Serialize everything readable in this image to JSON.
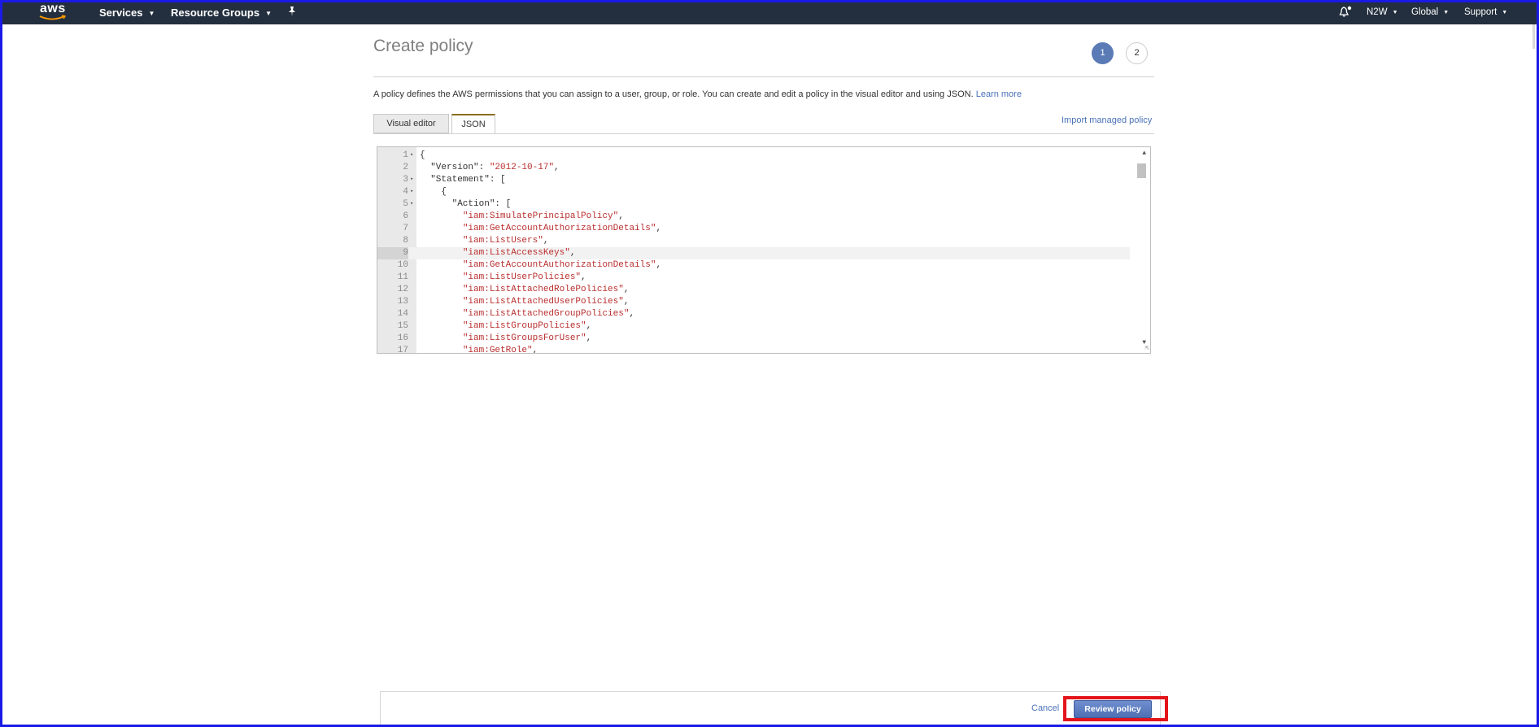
{
  "topnav": {
    "logo": "aws",
    "services": "Services",
    "resource_groups": "Resource Groups",
    "pin_icon": "pin-icon",
    "bell_icon": "bell-icon",
    "account": "N2W",
    "region": "Global",
    "support": "Support"
  },
  "page": {
    "title": "Create policy",
    "steps": [
      "1",
      "2"
    ],
    "active_step": "1",
    "description": "A policy defines the AWS permissions that you can assign to a user, group, or role. You can create and edit a policy in the visual editor and using JSON.",
    "learn_more": "Learn more"
  },
  "tabs": {
    "visual_editor": "Visual editor",
    "json": "JSON",
    "active": "JSON"
  },
  "import_link": "Import managed policy",
  "editor": {
    "active_line": 9,
    "lines": [
      {
        "n": "1",
        "fold": true,
        "pre": "{",
        "s": "",
        "post": ""
      },
      {
        "n": "2",
        "fold": false,
        "pre": "  \"Version\": ",
        "s": "\"2012-10-17\"",
        "post": ","
      },
      {
        "n": "3",
        "fold": true,
        "pre": "  \"Statement\": [",
        "s": "",
        "post": ""
      },
      {
        "n": "4",
        "fold": true,
        "pre": "    {",
        "s": "",
        "post": ""
      },
      {
        "n": "5",
        "fold": true,
        "pre": "      \"Action\": [",
        "s": "",
        "post": ""
      },
      {
        "n": "6",
        "fold": false,
        "pre": "        ",
        "s": "\"iam:SimulatePrincipalPolicy\"",
        "post": ","
      },
      {
        "n": "7",
        "fold": false,
        "pre": "        ",
        "s": "\"iam:GetAccountAuthorizationDetails\"",
        "post": ","
      },
      {
        "n": "8",
        "fold": false,
        "pre": "        ",
        "s": "\"iam:ListUsers\"",
        "post": ","
      },
      {
        "n": "9",
        "fold": false,
        "pre": "        ",
        "s": "\"iam:ListAccessKeys\"",
        "post": ","
      },
      {
        "n": "10",
        "fold": false,
        "pre": "        ",
        "s": "\"iam:GetAccountAuthorizationDetails\"",
        "post": ","
      },
      {
        "n": "11",
        "fold": false,
        "pre": "        ",
        "s": "\"iam:ListUserPolicies\"",
        "post": ","
      },
      {
        "n": "12",
        "fold": false,
        "pre": "        ",
        "s": "\"iam:ListAttachedRolePolicies\"",
        "post": ","
      },
      {
        "n": "13",
        "fold": false,
        "pre": "        ",
        "s": "\"iam:ListAttachedUserPolicies\"",
        "post": ","
      },
      {
        "n": "14",
        "fold": false,
        "pre": "        ",
        "s": "\"iam:ListAttachedGroupPolicies\"",
        "post": ","
      },
      {
        "n": "15",
        "fold": false,
        "pre": "        ",
        "s": "\"iam:ListGroupPolicies\"",
        "post": ","
      },
      {
        "n": "16",
        "fold": false,
        "pre": "        ",
        "s": "\"iam:ListGroupsForUser\"",
        "post": ","
      },
      {
        "n": "17",
        "fold": false,
        "pre": "        ",
        "s": "\"iam:GetRole\"",
        "post": ","
      }
    ]
  },
  "footer": {
    "cancel": "Cancel",
    "review_policy": "Review policy"
  },
  "colors": {
    "nav_bg": "#232f3e",
    "accent": "#5a7bb6",
    "link": "#4a72b8",
    "json_string": "#b92e2e",
    "highlight": "#e4141b",
    "window_border": "#1a1ae6"
  }
}
